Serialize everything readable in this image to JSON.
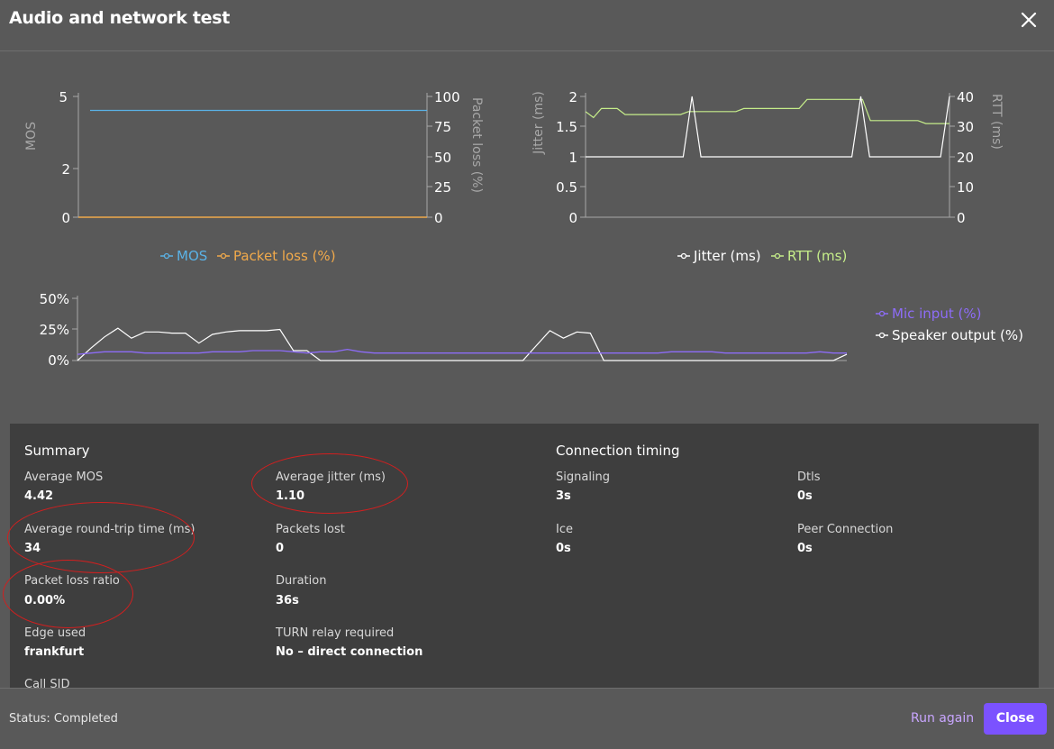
{
  "header": {
    "title": "Audio and network test"
  },
  "colors": {
    "mos": "#5ab2e6",
    "packet_loss": "#f0a94b",
    "jitter": "#ffffff",
    "rtt": "#c6ee8a",
    "mic": "#8d6cf7",
    "speaker": "#ffffff",
    "accent": "#7b52ff",
    "annotation": "#d21f1f"
  },
  "chart_data": [
    {
      "type": "line",
      "ylabel": "MOS",
      "y2label": "Packet loss (%)",
      "yticks": [
        "5",
        "2",
        "0"
      ],
      "y2ticks": [
        "100",
        "75",
        "50",
        "25",
        "0"
      ],
      "ylim": [
        0,
        5
      ],
      "y2lim": [
        0,
        100
      ],
      "legend_position": "bottom-center",
      "series": [
        {
          "name": "MOS",
          "axis": "left",
          "values": [
            4.42,
            4.42,
            4.42,
            4.42,
            4.42,
            4.42,
            4.42,
            4.42,
            4.42,
            4.42,
            4.42,
            4.42,
            4.42,
            4.42,
            4.42,
            4.42,
            4.42,
            4.42,
            4.42,
            4.42,
            4.42,
            4.42,
            4.42,
            4.42,
            4.42,
            4.42,
            4.42,
            4.42,
            4.42,
            4.42,
            4.42,
            4.42,
            4.42,
            4.42,
            4.42,
            4.42
          ]
        },
        {
          "name": "Packet loss (%)",
          "axis": "right",
          "values": [
            0,
            0,
            0,
            0,
            0,
            0,
            0,
            0,
            0,
            0,
            0,
            0,
            0,
            0,
            0,
            0,
            0,
            0,
            0,
            0,
            0,
            0,
            0,
            0,
            0,
            0,
            0,
            0,
            0,
            0,
            0,
            0,
            0,
            0,
            0,
            0
          ]
        }
      ]
    },
    {
      "type": "line",
      "ylabel": "Jitter (ms)",
      "y2label": "RTT (ms)",
      "yticks": [
        "2",
        "1.5",
        "1",
        "0.5",
        "0"
      ],
      "y2ticks": [
        "40",
        "30",
        "20",
        "10",
        "0"
      ],
      "ylim": [
        0,
        2
      ],
      "y2lim": [
        0,
        40
      ],
      "legend_position": "bottom-center",
      "series": [
        {
          "name": "Jitter (ms)",
          "axis": "left",
          "values": [
            1,
            1,
            1,
            1,
            1,
            1,
            1,
            1,
            1,
            1,
            1,
            1,
            2,
            1,
            1,
            1,
            1,
            1,
            1,
            1,
            1,
            1,
            1,
            1,
            1,
            1,
            1,
            1,
            1,
            1,
            1,
            2,
            1,
            1,
            1,
            1,
            1,
            1,
            1,
            1,
            1,
            2
          ]
        },
        {
          "name": "RTT (ms)",
          "axis": "right",
          "values": [
            35,
            33,
            36,
            36,
            36,
            34,
            34,
            34,
            34,
            34,
            34,
            34,
            34,
            35,
            35,
            35,
            35,
            35,
            35,
            35,
            36,
            36,
            36,
            36,
            36,
            36,
            36,
            36,
            39,
            39,
            39,
            39,
            39,
            39,
            39,
            39,
            32,
            32,
            32,
            32,
            32,
            32,
            32,
            31,
            31,
            31,
            31
          ]
        }
      ]
    },
    {
      "type": "line",
      "yticks": [
        "50%",
        "25%",
        "0%"
      ],
      "ylim": [
        0,
        50
      ],
      "legend_position": "right",
      "series": [
        {
          "name": "Mic input (%)",
          "values": [
            5,
            6,
            7,
            7,
            7,
            6,
            6,
            6,
            6,
            6,
            7,
            7,
            7,
            8,
            8,
            8,
            7,
            6,
            7,
            7,
            9,
            7,
            6,
            6,
            6,
            6,
            6,
            6,
            6,
            6,
            6,
            6,
            6,
            6,
            6,
            6,
            6,
            6,
            6,
            6,
            6,
            6,
            6,
            6,
            7,
            7,
            7,
            7,
            6,
            6,
            6,
            6,
            6,
            6,
            6,
            7,
            6,
            6
          ]
        },
        {
          "name": "Speaker output (%)",
          "values": [
            0,
            10,
            19,
            26,
            18,
            23,
            23,
            22,
            22,
            14,
            21,
            23,
            24,
            24,
            24,
            25,
            8,
            8,
            0,
            0,
            0,
            0,
            0,
            0,
            0,
            0,
            0,
            0,
            0,
            0,
            0,
            0,
            0,
            0,
            12,
            24,
            18,
            23,
            22,
            0,
            0,
            0,
            0,
            0,
            0,
            0,
            0,
            0,
            0,
            0,
            0,
            0,
            0,
            0,
            0,
            0,
            0,
            5
          ]
        }
      ]
    }
  ],
  "summary": {
    "title": "Summary",
    "items": [
      {
        "label": "Average MOS",
        "value": "4.42"
      },
      {
        "label": "Average jitter (ms)",
        "value": "1.10"
      },
      {
        "label": "Average round-trip time (ms)",
        "value": "34"
      },
      {
        "label": "Packets lost",
        "value": "0"
      },
      {
        "label": "Packet loss ratio",
        "value": "0.00%"
      },
      {
        "label": "Duration",
        "value": "36s"
      },
      {
        "label": "Edge used",
        "value": "frankfurt"
      },
      {
        "label": "TURN relay required",
        "value": "No – direct connection"
      },
      {
        "label": "Call SID",
        "value": ""
      }
    ]
  },
  "timing": {
    "title": "Connection timing",
    "items": [
      {
        "label": "Signaling",
        "value": "3s"
      },
      {
        "label": "Dtls",
        "value": "0s"
      },
      {
        "label": "Ice",
        "value": "0s"
      },
      {
        "label": "Peer Connection",
        "value": "0s"
      }
    ]
  },
  "footer": {
    "status": "Status: Completed",
    "run_again": "Run again",
    "close": "Close"
  }
}
